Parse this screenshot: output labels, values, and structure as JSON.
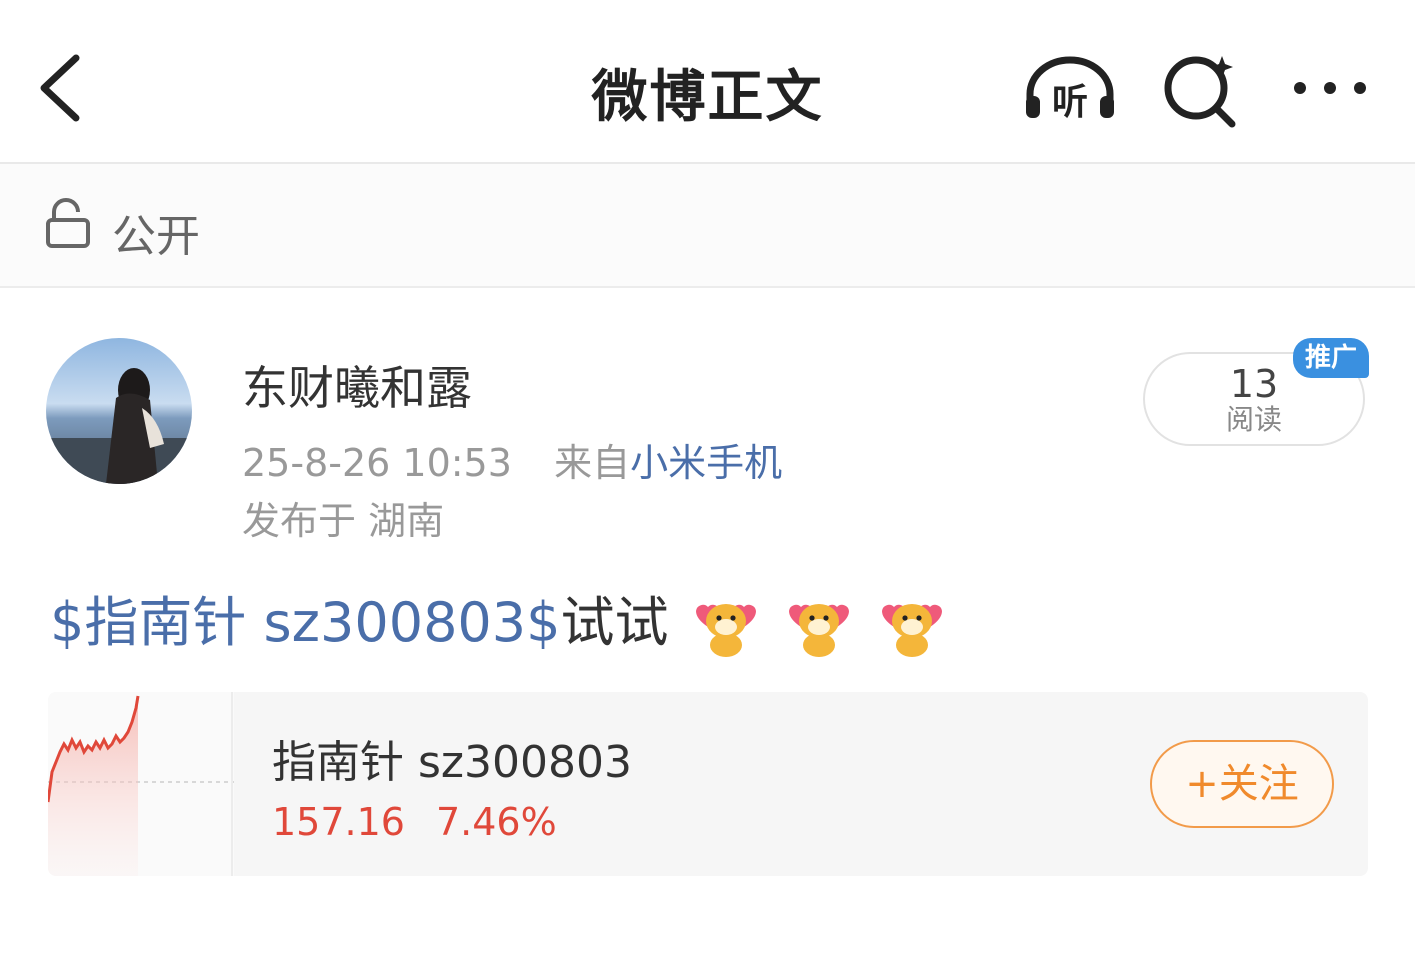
{
  "header": {
    "title": "微博正文",
    "listen_label": "听"
  },
  "visibility": {
    "label": "公开"
  },
  "post": {
    "username": "东财曦和露",
    "timestamp": "25-8-26 10:53",
    "source_prefix": "来自",
    "source": "小米手机",
    "location": "发布于 湖南",
    "reads": {
      "count": "13",
      "label": "阅读"
    },
    "promo_badge": "推广",
    "text_topic": "$指南针 sz300803$",
    "text_body": "试试"
  },
  "stock_card": {
    "name": "指南针 sz300803",
    "price": "157.16",
    "change": "7.46%",
    "follow_label": "+关注"
  },
  "colors": {
    "link": "#4a6ea9",
    "up": "#e0483a",
    "accent_orange": "#f08a2c",
    "badge_blue": "#3a90e0"
  }
}
